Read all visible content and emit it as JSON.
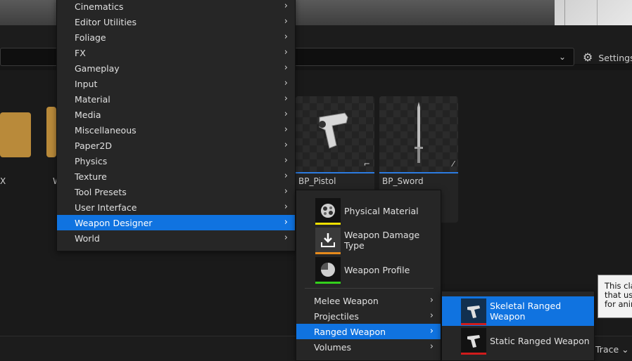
{
  "toolbar": {
    "settings_label": "Settings"
  },
  "assets": {
    "left_label_1": "X",
    "left_label_2": "W",
    "tiles": [
      {
        "label": "BP_Pistol",
        "icon": "pistol-icon"
      },
      {
        "label": "BP_Sword",
        "icon": "sword-icon"
      }
    ]
  },
  "main_menu": {
    "items": [
      {
        "label": "Cinematics"
      },
      {
        "label": "Editor Utilities"
      },
      {
        "label": "Foliage"
      },
      {
        "label": "FX"
      },
      {
        "label": "Gameplay"
      },
      {
        "label": "Input"
      },
      {
        "label": "Material"
      },
      {
        "label": "Media"
      },
      {
        "label": "Miscellaneous"
      },
      {
        "label": "Paper2D"
      },
      {
        "label": "Physics"
      },
      {
        "label": "Texture"
      },
      {
        "label": "Tool Presets"
      },
      {
        "label": "User Interface"
      },
      {
        "label": "Weapon Designer"
      },
      {
        "label": "World"
      }
    ],
    "active": "Weapon Designer"
  },
  "weapon_menu": {
    "asset_items": [
      {
        "label": "Physical Material",
        "icon": "physical-material-icon",
        "color": "#f0e000"
      },
      {
        "label": "Weapon Damage Type",
        "icon": "damage-type-icon",
        "color": "#e68a1c"
      },
      {
        "label": "Weapon Profile",
        "icon": "profile-pie-icon",
        "color": "#34d01c"
      }
    ],
    "category_items": [
      {
        "label": "Melee Weapon"
      },
      {
        "label": "Projectiles"
      },
      {
        "label": "Ranged Weapon"
      },
      {
        "label": "Volumes"
      }
    ],
    "active": "Ranged Weapon"
  },
  "ranged_menu": {
    "items": [
      {
        "label": "Skeletal Ranged Weapon",
        "icon": "skeletal-gun-icon",
        "color": "#d01c1c"
      },
      {
        "label": "Static Ranged Weapon",
        "icon": "static-gun-icon",
        "color": "#d01c1c"
      }
    ],
    "active": "Skeletal Ranged Weapon"
  },
  "tooltip": {
    "lines": [
      "This cla",
      "that us",
      "for anir"
    ]
  },
  "bottom": {
    "trace_label": "Trace"
  }
}
